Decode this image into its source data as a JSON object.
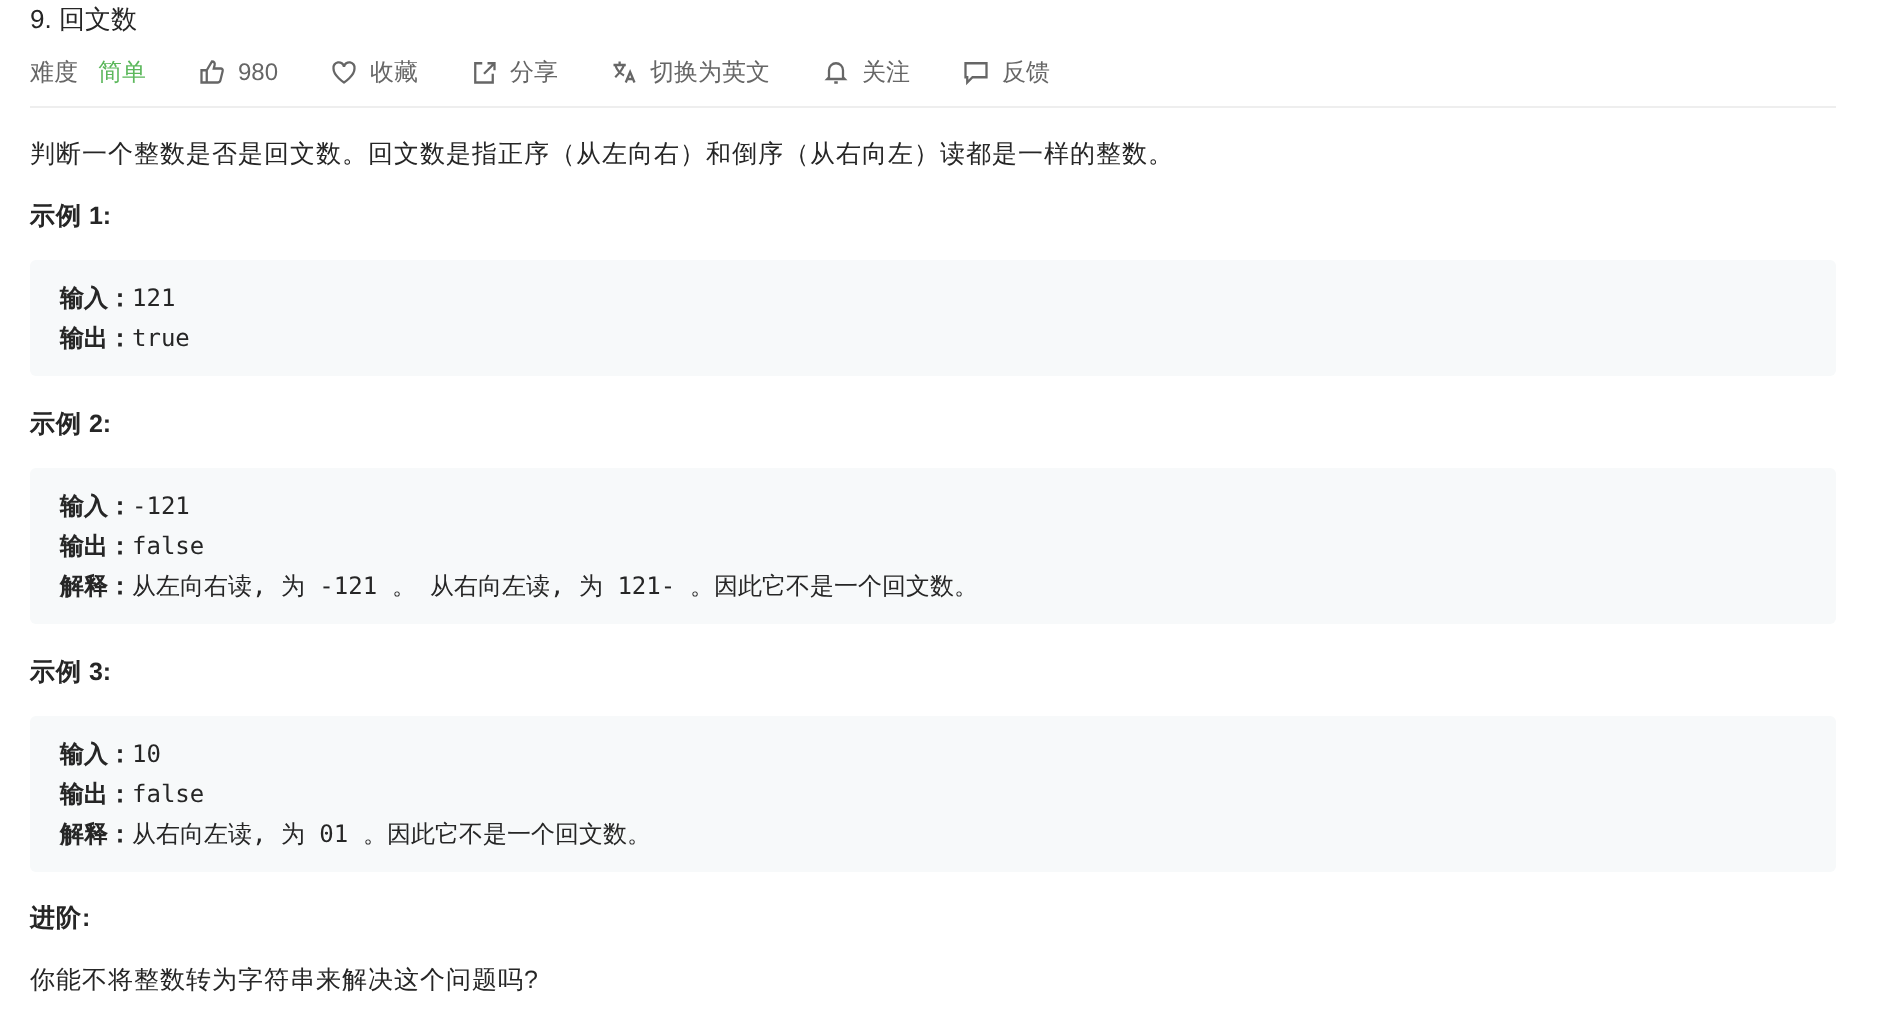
{
  "title": "9. 回文数",
  "meta": {
    "difficulty_label": "难度",
    "difficulty": "简单",
    "actions": [
      {
        "kind": "like",
        "label": "980"
      },
      {
        "kind": "favorite",
        "label": "收藏"
      },
      {
        "kind": "share",
        "label": "分享"
      },
      {
        "kind": "translate",
        "label": "切换为英文"
      },
      {
        "kind": "follow",
        "label": "关注"
      },
      {
        "kind": "feedback",
        "label": "反馈"
      }
    ]
  },
  "description": "判断一个整数是否是回文数。回文数是指正序（从左向右）和倒序（从右向左）读都是一样的整数。",
  "examples": [
    {
      "heading": "示例 1:",
      "lines": [
        "**输入：**121",
        "**输出：**true"
      ]
    },
    {
      "heading": "示例 2:",
      "lines": [
        "**输入：**-121",
        "**输出：**false",
        "**解释：**从左向右读, 为 -121 。 从右向左读, 为 121- 。因此它不是一个回文数。"
      ]
    },
    {
      "heading": "示例 3:",
      "lines": [
        "**输入：**10",
        "**输出：**false",
        "**解释：**从右向左读, 为 01 。因此它不是一个回文数。"
      ]
    }
  ],
  "advanced": {
    "heading": "进阶:",
    "text": "你能不将整数转为字符串来解决这个问题吗?"
  }
}
